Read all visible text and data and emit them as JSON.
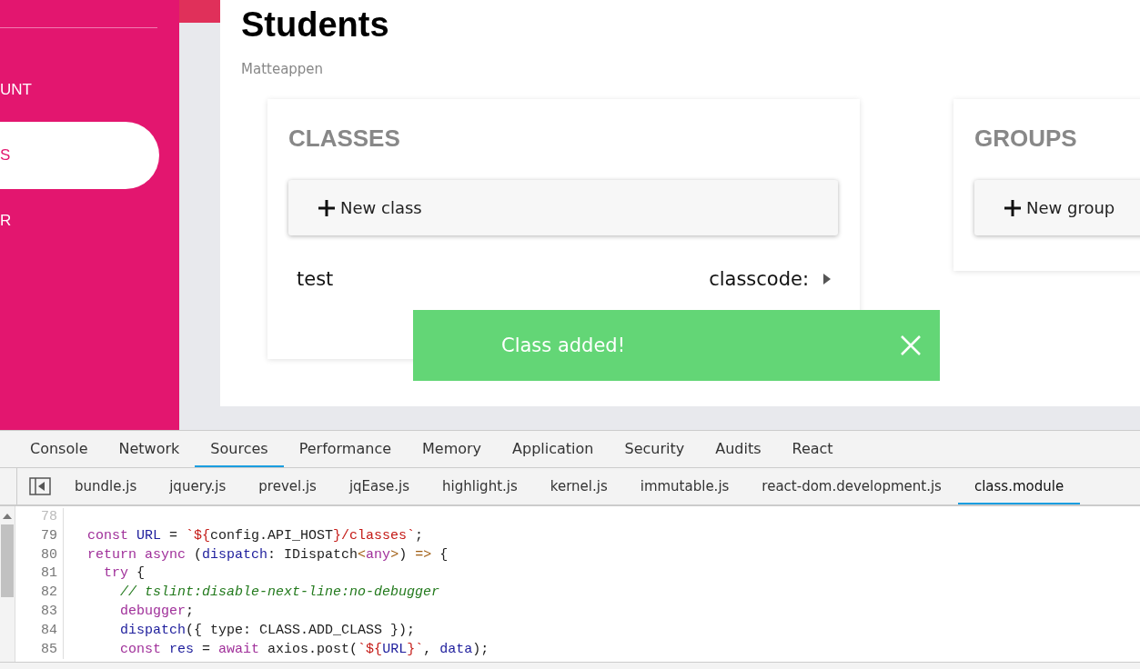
{
  "sidebar": {
    "items": [
      {
        "label": "UNT",
        "selected": false
      },
      {
        "label": "S",
        "selected": true
      },
      {
        "label": "R",
        "selected": false
      }
    ]
  },
  "page": {
    "title": "Students",
    "subtitle": "Matteappen"
  },
  "cards": [
    {
      "title": "CLASSES",
      "button": "New class",
      "rows": [
        {
          "name": "test",
          "code_label": "classcode:"
        }
      ]
    },
    {
      "title": "GROUPS",
      "button": "New group"
    }
  ],
  "toast": {
    "message": "Class added!"
  },
  "devtools": {
    "tabs": [
      {
        "label": "Console",
        "selected": false
      },
      {
        "label": "Network",
        "selected": false
      },
      {
        "label": "Sources",
        "selected": true
      },
      {
        "label": "Performance",
        "selected": false
      },
      {
        "label": "Memory",
        "selected": false
      },
      {
        "label": "Application",
        "selected": false
      },
      {
        "label": "Security",
        "selected": false
      },
      {
        "label": "Audits",
        "selected": false
      },
      {
        "label": "React",
        "selected": false
      }
    ],
    "files": [
      {
        "label": "bundle.js",
        "selected": false
      },
      {
        "label": "jquery.js",
        "selected": false
      },
      {
        "label": "prevel.js",
        "selected": false
      },
      {
        "label": "jqEase.js",
        "selected": false
      },
      {
        "label": "highlight.js",
        "selected": false
      },
      {
        "label": "kernel.js",
        "selected": false
      },
      {
        "label": "immutable.js",
        "selected": false
      },
      {
        "label": "react-dom.development.js",
        "selected": false
      },
      {
        "label": "class.module",
        "selected": true
      }
    ],
    "code": [
      {
        "number": "78"
      },
      {
        "number": "79",
        "tokens": [
          {
            "t": "  const",
            "kind": "keyword"
          },
          {
            "t": " URL",
            "kind": "name"
          },
          {
            "t": " = ",
            "kind": "plain"
          },
          {
            "t": "`${",
            "kind": "string"
          },
          {
            "t": "config.API_HOST",
            "kind": "plain"
          },
          {
            "t": "}/classes`",
            "kind": "string"
          },
          {
            "t": ";",
            "kind": "plain"
          }
        ]
      },
      {
        "number": "80",
        "tokens": [
          {
            "t": "  return async",
            "kind": "keyword"
          },
          {
            "t": " (",
            "kind": "plain"
          },
          {
            "t": "dispatch",
            "kind": "name"
          },
          {
            "t": ": IDispatch",
            "kind": "plain"
          },
          {
            "t": "<",
            "kind": "operator"
          },
          {
            "t": "any",
            "kind": "keyword"
          },
          {
            "t": ">",
            "kind": "operator"
          },
          {
            "t": ") ",
            "kind": "plain"
          },
          {
            "t": "=>",
            "kind": "operator"
          },
          {
            "t": " {",
            "kind": "plain"
          }
        ]
      },
      {
        "number": "81",
        "tokens": [
          {
            "t": "    try",
            "kind": "keyword"
          },
          {
            "t": " {",
            "kind": "plain"
          }
        ]
      },
      {
        "number": "82",
        "tokens": [
          {
            "t": "      // tslint:disable-next-line:no-debugger",
            "kind": "comment"
          }
        ]
      },
      {
        "number": "83",
        "tokens": [
          {
            "t": "      debugger",
            "kind": "keyword"
          },
          {
            "t": ";",
            "kind": "plain"
          }
        ]
      },
      {
        "number": "84",
        "tokens": [
          {
            "t": "      dispatch",
            "kind": "name"
          },
          {
            "t": "({ type: CLASS.ADD_CLASS });",
            "kind": "plain"
          }
        ]
      },
      {
        "number": "85",
        "tokens": [
          {
            "t": "      const",
            "kind": "keyword"
          },
          {
            "t": " res",
            "kind": "name"
          },
          {
            "t": " = ",
            "kind": "plain"
          },
          {
            "t": "await",
            "kind": "keyword"
          },
          {
            "t": " axios.post(",
            "kind": "plain"
          },
          {
            "t": "`${",
            "kind": "string"
          },
          {
            "t": "URL",
            "kind": "name"
          },
          {
            "t": "}`",
            "kind": "string"
          },
          {
            "t": ", ",
            "kind": "plain"
          },
          {
            "t": "data",
            "kind": "name"
          },
          {
            "t": ");",
            "kind": "plain"
          }
        ]
      }
    ]
  }
}
